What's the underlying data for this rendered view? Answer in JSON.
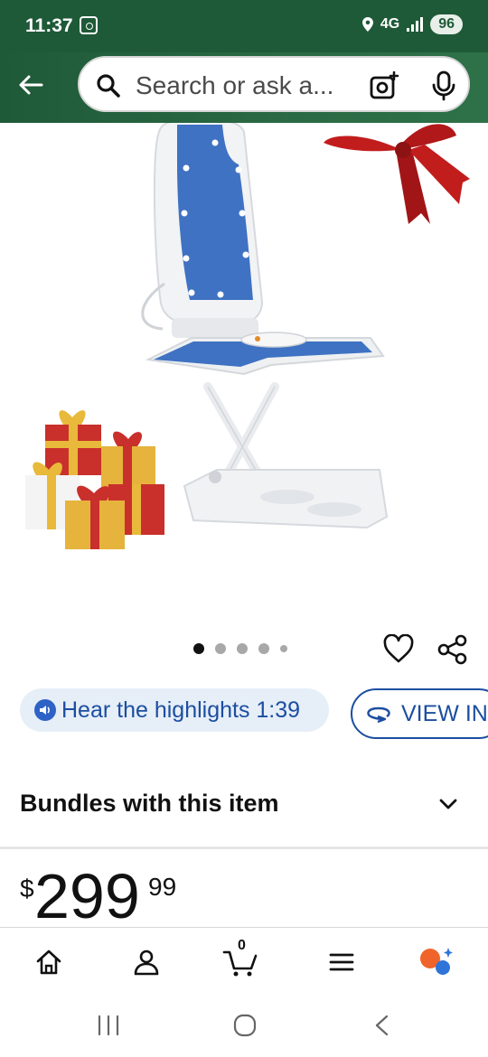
{
  "status_bar": {
    "time": "11:37",
    "network": "4G",
    "battery": "96"
  },
  "header": {
    "search_placeholder": "Search or ask a..."
  },
  "product": {
    "image_icon": "shower-chair-image",
    "carousel": {
      "total": 5,
      "active_index": 0
    }
  },
  "actions": {
    "highlights_label": "Hear the highlights 1:39",
    "view_in_label": "VIEW IN"
  },
  "bundles": {
    "title": "Bundles with this item"
  },
  "price": {
    "currency": "$",
    "whole": "299",
    "cents": "99"
  },
  "bottom_nav": {
    "cart_count": "0",
    "items": [
      "home-icon",
      "account-icon",
      "cart-icon",
      "menu-icon",
      "assistant-icon"
    ]
  },
  "colors": {
    "header_green": "#1f5a38",
    "link_blue": "#1c4ea0",
    "pill_bg": "#e6eef8"
  }
}
